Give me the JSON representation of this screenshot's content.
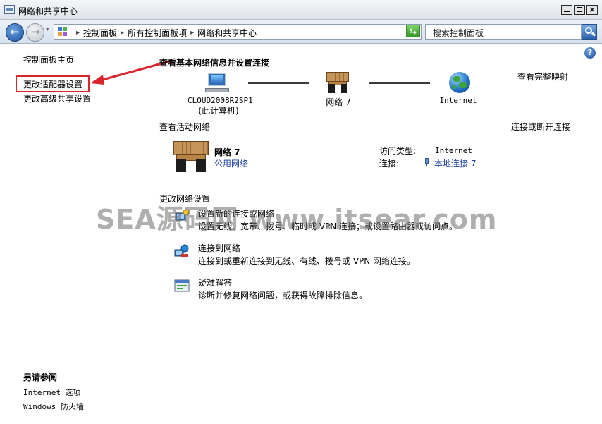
{
  "window": {
    "title": "网络和共享中心"
  },
  "nav": {
    "breadcrumbs": [
      "控制面板",
      "所有控制面板项",
      "网络和共享中心"
    ],
    "search_placeholder": "搜索控制面板"
  },
  "sidebar": {
    "items": [
      {
        "label": "控制面板主页"
      },
      {
        "label": "更改适配器设置",
        "highlighted": true
      },
      {
        "label": "更改高级共享设置"
      }
    ],
    "see_also_title": "另请参阅",
    "see_also": [
      {
        "label": "Internet 选项"
      },
      {
        "label": "Windows 防火墙"
      }
    ]
  },
  "main": {
    "heading": "查看基本网络信息并设置连接",
    "full_map_link": "查看完整映射",
    "map": {
      "computer_name": "CLOUD2008R2SP1",
      "computer_sub": "(此计算机)",
      "network_name": "网络  7",
      "internet_label": "Internet"
    },
    "active_networks": {
      "title": "查看活动网络",
      "connect_link": "连接或断开连接",
      "network_name": "网络  7",
      "network_type": "公用网络",
      "access_type_label": "访问类型:",
      "access_type_value": "Internet",
      "connections_label": "连接:",
      "connection_value": "本地连接 7"
    },
    "change_settings": {
      "title": "更改网络设置",
      "tasks": [
        {
          "title": "设置新的连接或网络",
          "desc": "设置无线、宽带、拨号、临时或 VPN 连接；或设置路由器或访问点。"
        },
        {
          "title": "连接到网络",
          "desc": "连接到或重新连接到无线、有线、拨号或 VPN 网络连接。"
        },
        {
          "title": "疑难解答",
          "desc": "诊断并修复网络问题，或获得故障排除信息。"
        }
      ]
    }
  },
  "watermark": "SEA源码网 www.itsear.com",
  "colors": {
    "annotation_red": "#d9252b",
    "link_blue": "#1a3f9e"
  }
}
